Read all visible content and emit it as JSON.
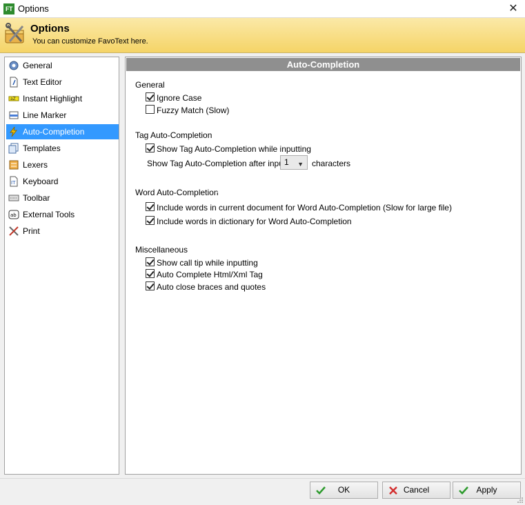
{
  "window": {
    "title": "Options",
    "badge": "FT",
    "close_glyph": "✕"
  },
  "header": {
    "title": "Options",
    "subtitle": "You can customize FavoText here."
  },
  "nav": {
    "items": [
      {
        "label": "General",
        "icon": "gear-icon"
      },
      {
        "label": "Text Editor",
        "icon": "document-icon"
      },
      {
        "label": "Instant Highlight",
        "icon": "highlight-icon"
      },
      {
        "label": "Line Marker",
        "icon": "marker-icon"
      },
      {
        "label": "Auto-Completion",
        "icon": "lightning-icon",
        "selected": true
      },
      {
        "label": "Templates",
        "icon": "templates-icon"
      },
      {
        "label": "Lexers",
        "icon": "lexers-icon"
      },
      {
        "label": "Keyboard",
        "icon": "keyboard-icon"
      },
      {
        "label": "Toolbar",
        "icon": "toolbar-icon"
      },
      {
        "label": "External Tools",
        "icon": "external-tools-icon"
      },
      {
        "label": "Print",
        "icon": "print-icon"
      }
    ]
  },
  "panel": {
    "title": "Auto-Completion",
    "general": {
      "label": "General",
      "ignore_case": {
        "label": "Ignore Case",
        "checked": true
      },
      "fuzzy_match": {
        "label": "Fuzzy Match (Slow)",
        "checked": false
      }
    },
    "tag": {
      "label": "Tag Auto-Completion",
      "show_while_inputting": {
        "label": "Show Tag Auto-Completion while inputting",
        "checked": true
      },
      "after_input_label": "Show Tag Auto-Completion after input",
      "after_input_value": "1",
      "after_input_unit": "characters"
    },
    "word": {
      "label": "Word Auto-Completion",
      "current_doc": {
        "label": "Include words in current document for Word Auto-Completion (Slow for large file)",
        "checked": true
      },
      "dictionary": {
        "label": "Include words in dictionary for Word Auto-Completion",
        "checked": true
      }
    },
    "misc": {
      "label": "Miscellaneous",
      "call_tip": {
        "label": "Show call tip while inputting",
        "checked": true
      },
      "html_xml": {
        "label": "Auto Complete Html/Xml Tag",
        "checked": true
      },
      "braces": {
        "label": "Auto close braces and quotes",
        "checked": true
      }
    }
  },
  "buttons": {
    "ok": "OK",
    "cancel": "Cancel",
    "apply": "Apply"
  },
  "colors": {
    "selection": "#3399ff",
    "header_gradient_top": "#fbe9a8",
    "header_gradient_bottom": "#f5d467",
    "panel_head": "#8f8f8f"
  }
}
